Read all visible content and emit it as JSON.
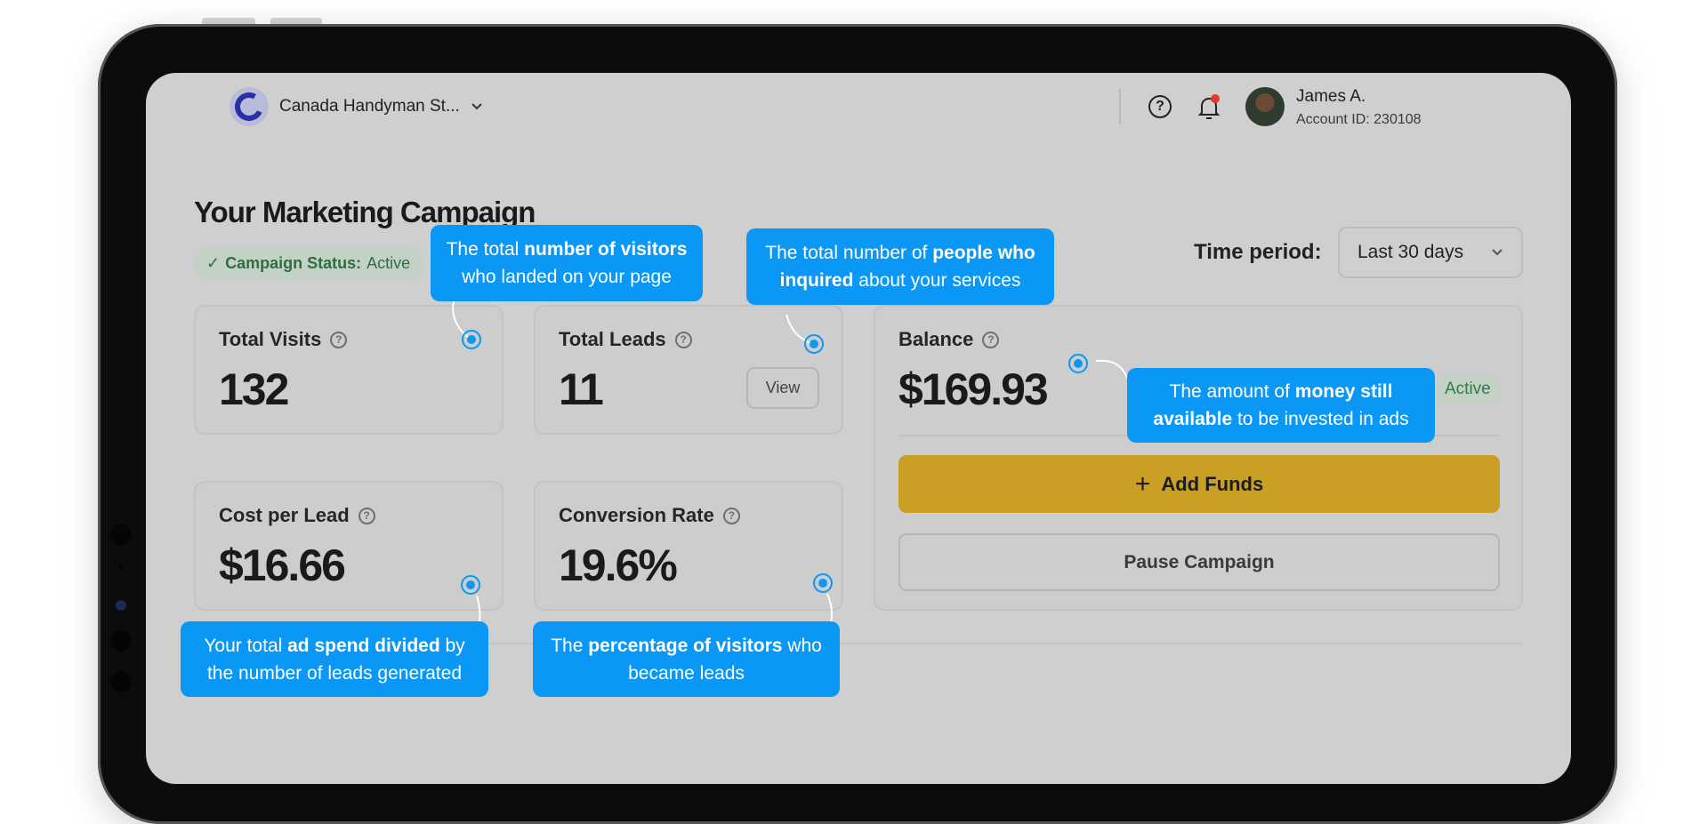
{
  "header": {
    "company_name": "Canada Handyman St...",
    "user_name": "James A.",
    "account_id": "Account ID: 230108"
  },
  "page": {
    "title": "Your Marketing Campaign",
    "status_label": "Campaign Status:",
    "status_value": "Active",
    "time_period_label": "Time period:",
    "time_period_value": "Last 30 days"
  },
  "metrics": {
    "total_visits": {
      "label": "Total Visits",
      "value": "132"
    },
    "total_leads": {
      "label": "Total Leads",
      "value": "11",
      "button": "View"
    },
    "cost_per_lead": {
      "label": "Cost per Lead",
      "value": "$16.66"
    },
    "conversion_rate": {
      "label": "Conversion Rate",
      "value": "19.6%"
    },
    "balance": {
      "label": "Balance",
      "value": "$169.93",
      "badge": "Active",
      "add_funds": "Add Funds",
      "pause": "Pause Campaign"
    }
  },
  "tooltips": {
    "visits": [
      "The total ",
      "number of visitors",
      "who landed on your page"
    ],
    "leads": [
      "The total number of ",
      "people who inquired",
      " about your services"
    ],
    "balance": [
      "The amount of ",
      "money still available",
      " to be invested in ads"
    ],
    "cpl": [
      "Your total ",
      "ad spend divided",
      " by the number of leads generated"
    ],
    "conversion": [
      "The ",
      "percentage of visitors",
      " who became leads"
    ]
  },
  "colors": {
    "tooltip": "#0b97f6",
    "add_funds": "#c9a024",
    "active_green": "#2e7d45"
  }
}
